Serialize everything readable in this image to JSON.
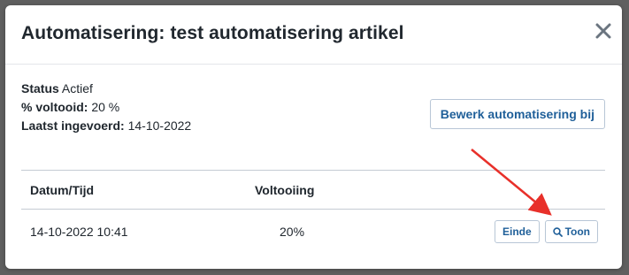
{
  "modal": {
    "title": "Automatisering: test automatisering artikel",
    "close_icon": "close-icon"
  },
  "info": {
    "status_label": "Status",
    "status_value": "Actief",
    "progress_label": "% voltooid:",
    "progress_value": "20 %",
    "last_entered_label": "Laatst ingevoerd:",
    "last_entered_value": "14-10-2022"
  },
  "edit_button_label": "Bewerk automatisering bij",
  "table": {
    "headers": [
      "Datum/Tijd",
      "Voltooiing"
    ],
    "rows": [
      {
        "datetime": "14-10-2022 10:41",
        "completion": "20%",
        "end_label": "Einde",
        "show_label": "Toon",
        "show_icon": "search-icon"
      }
    ]
  },
  "colors": {
    "accent": "#1f5f99",
    "annotation_arrow": "#e8302a"
  }
}
